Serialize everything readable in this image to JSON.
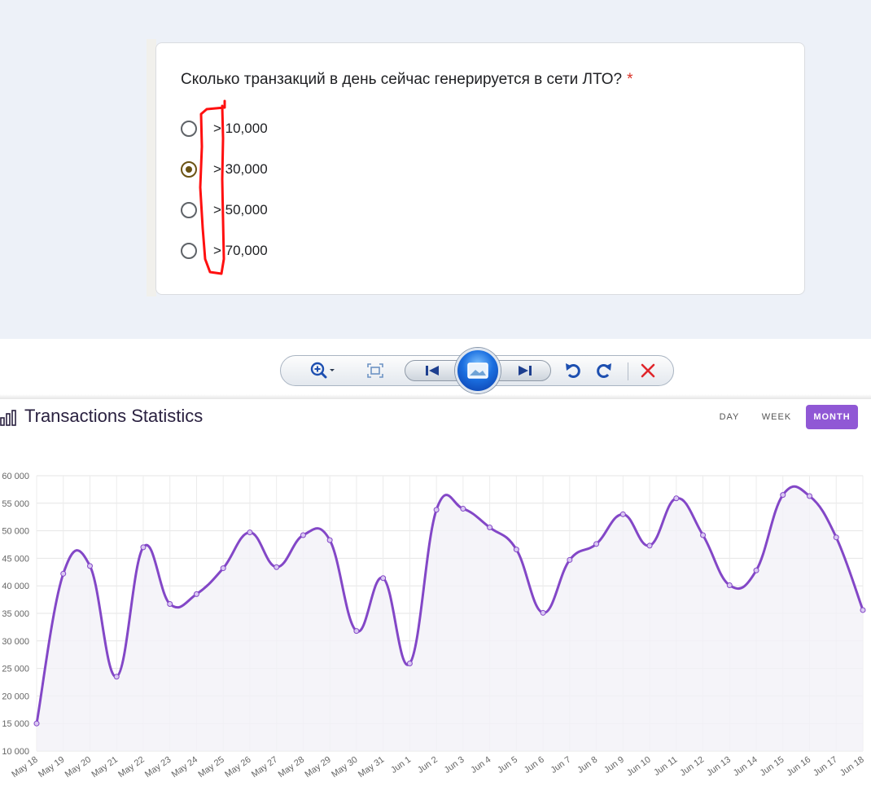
{
  "form": {
    "question": "Сколько транзакций в день сейчас генерируется в сети ЛТО?",
    "required_mark": "*",
    "options": [
      {
        "label": "> 10,000",
        "checked": false
      },
      {
        "label": "> 30,000",
        "checked": true
      },
      {
        "label": "> 50,000",
        "checked": false
      },
      {
        "label": "> 70,000",
        "checked": false
      }
    ]
  },
  "viewer_toolbar": {
    "icons": [
      "zoom-icon",
      "fit-window-icon",
      "previous-icon",
      "slideshow-icon",
      "next-icon",
      "rotate-left-icon",
      "rotate-right-icon",
      "delete-icon"
    ]
  },
  "stats": {
    "title": "Transactions Statistics",
    "periods": [
      "DAY",
      "WEEK",
      "MONTH"
    ],
    "active_period": "MONTH",
    "accent_color": "#9058d5"
  },
  "chart_data": {
    "type": "line",
    "title": "Transactions Statistics",
    "categories": [
      "May 18",
      "May 19",
      "May 20",
      "May 21",
      "May 22",
      "May 23",
      "May 24",
      "May 25",
      "May 26",
      "May 27",
      "May 28",
      "May 29",
      "May 30",
      "May 31",
      "Jun 1",
      "Jun 2",
      "Jun 3",
      "Jun 4",
      "Jun 5",
      "Jun 6",
      "Jun 7",
      "Jun 8",
      "Jun 9",
      "Jun 10",
      "Jun 11",
      "Jun 12",
      "Jun 13",
      "Jun 14",
      "Jun 15",
      "Jun 16",
      "Jun 17",
      "Jun 18"
    ],
    "values": [
      15000,
      42200,
      43600,
      23500,
      47000,
      36700,
      38500,
      43200,
      49700,
      43400,
      49200,
      48300,
      31800,
      41400,
      25900,
      53800,
      54000,
      50600,
      46600,
      35100,
      44700,
      47600,
      53000,
      47300,
      55900,
      49200,
      40100,
      42800,
      56500,
      56300,
      48800,
      35600
    ],
    "y_ticks": [
      "10 000",
      "15 000",
      "20 000",
      "25 000",
      "30 000",
      "35 000",
      "40 000",
      "45 000",
      "50 000",
      "55 000",
      "60 000"
    ],
    "ylim": [
      10000,
      60000
    ],
    "grid": true,
    "line_color": "#8347c7"
  }
}
